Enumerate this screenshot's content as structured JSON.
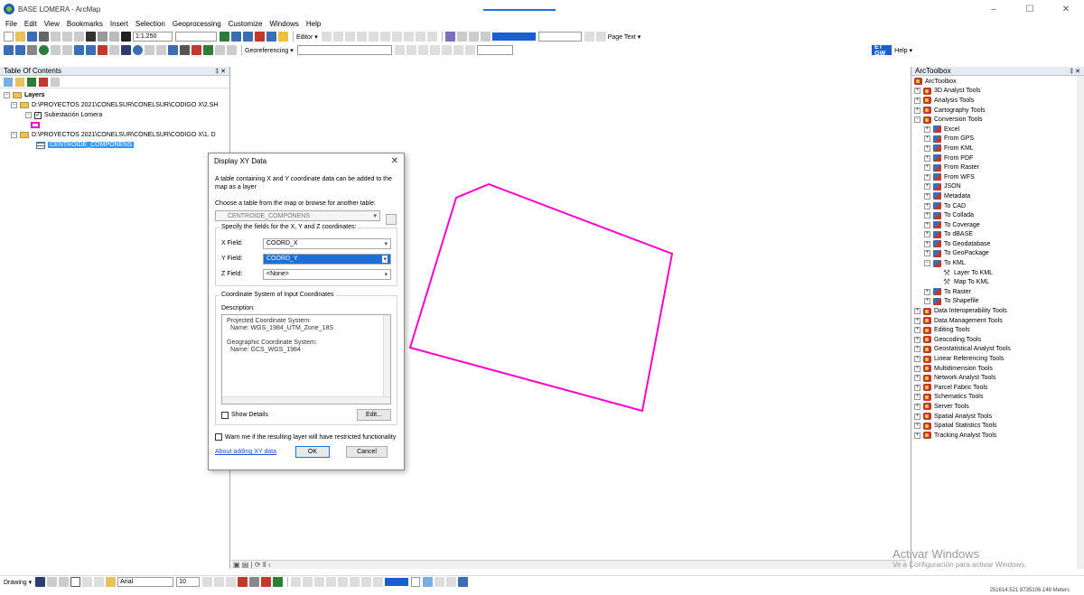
{
  "window": {
    "title": "BASE LOMERA - ArcMap",
    "controls": [
      "–",
      "☐",
      "✕"
    ]
  },
  "menu": [
    "File",
    "Edit",
    "View",
    "Bookmarks",
    "Insert",
    "Selection",
    "Geoprocessing",
    "Customize",
    "Windows",
    "Help"
  ],
  "toolbar": {
    "scale": "1:1.250",
    "editor_label": "Editor ▾",
    "page_text_label": "Page Text ▾",
    "georeferencing_label": "Georeferencing ▾",
    "help_label": "Help ▾",
    "etgw_label": "ET GW"
  },
  "toc": {
    "title": "Table Of Contents",
    "pins": "‡ ✕",
    "layers_label": "Layers",
    "folder1": "D:\\PROYECTOS 2021\\CONELSUR\\CONELSUR\\CODIGO X\\2.SH",
    "layer1": "Subestación Lomera",
    "folder2": "D:\\PROYECTOS 2021\\CONELSUR\\CONELSUR\\CODIGO X\\1. D",
    "table1": "CENTROIDE_COMPONENS"
  },
  "arctoolbox": {
    "title": "ArcToolbox",
    "pins": "‡ ✕",
    "root": "ArcToolbox",
    "items": [
      {
        "level": 1,
        "kind": "box",
        "exp": "+",
        "label": "3D Analyst Tools"
      },
      {
        "level": 1,
        "kind": "box",
        "exp": "+",
        "label": "Analysis Tools"
      },
      {
        "level": 1,
        "kind": "box",
        "exp": "+",
        "label": "Cartography Tools"
      },
      {
        "level": 1,
        "kind": "box",
        "exp": "-",
        "label": "Conversion Tools"
      },
      {
        "level": 2,
        "kind": "set",
        "exp": "+",
        "label": "Excel"
      },
      {
        "level": 2,
        "kind": "set",
        "exp": "+",
        "label": "From GPS"
      },
      {
        "level": 2,
        "kind": "set",
        "exp": "+",
        "label": "From KML"
      },
      {
        "level": 2,
        "kind": "set",
        "exp": "+",
        "label": "From PDF"
      },
      {
        "level": 2,
        "kind": "set",
        "exp": "+",
        "label": "From Raster"
      },
      {
        "level": 2,
        "kind": "set",
        "exp": "+",
        "label": "From WFS"
      },
      {
        "level": 2,
        "kind": "set",
        "exp": "+",
        "label": "JSON"
      },
      {
        "level": 2,
        "kind": "set",
        "exp": "+",
        "label": "Metadata"
      },
      {
        "level": 2,
        "kind": "set",
        "exp": "+",
        "label": "To CAD"
      },
      {
        "level": 2,
        "kind": "set",
        "exp": "+",
        "label": "To Collada"
      },
      {
        "level": 2,
        "kind": "set",
        "exp": "+",
        "label": "To Coverage"
      },
      {
        "level": 2,
        "kind": "set",
        "exp": "+",
        "label": "To dBASE"
      },
      {
        "level": 2,
        "kind": "set",
        "exp": "+",
        "label": "To Geodatabase"
      },
      {
        "level": 2,
        "kind": "set",
        "exp": "+",
        "label": "To GeoPackage"
      },
      {
        "level": 2,
        "kind": "set",
        "exp": "-",
        "label": "To KML"
      },
      {
        "level": 3,
        "kind": "tool",
        "exp": "",
        "label": "Layer To KML"
      },
      {
        "level": 3,
        "kind": "tool",
        "exp": "",
        "label": "Map To KML"
      },
      {
        "level": 2,
        "kind": "set",
        "exp": "+",
        "label": "To Raster"
      },
      {
        "level": 2,
        "kind": "set",
        "exp": "+",
        "label": "To Shapefile"
      },
      {
        "level": 1,
        "kind": "box",
        "exp": "+",
        "label": "Data Interoperability Tools"
      },
      {
        "level": 1,
        "kind": "box",
        "exp": "+",
        "label": "Data Management Tools"
      },
      {
        "level": 1,
        "kind": "box",
        "exp": "+",
        "label": "Editing Tools"
      },
      {
        "level": 1,
        "kind": "box",
        "exp": "+",
        "label": "Geocoding Tools"
      },
      {
        "level": 1,
        "kind": "box",
        "exp": "+",
        "label": "Geostatistical Analyst Tools"
      },
      {
        "level": 1,
        "kind": "box",
        "exp": "+",
        "label": "Linear Referencing Tools"
      },
      {
        "level": 1,
        "kind": "box",
        "exp": "+",
        "label": "Multidimension Tools"
      },
      {
        "level": 1,
        "kind": "box",
        "exp": "+",
        "label": "Network Analyst Tools"
      },
      {
        "level": 1,
        "kind": "box",
        "exp": "+",
        "label": "Parcel Fabric Tools"
      },
      {
        "level": 1,
        "kind": "box",
        "exp": "+",
        "label": "Schematics Tools"
      },
      {
        "level": 1,
        "kind": "box",
        "exp": "+",
        "label": "Server Tools"
      },
      {
        "level": 1,
        "kind": "box",
        "exp": "+",
        "label": "Spatial Analyst Tools"
      },
      {
        "level": 1,
        "kind": "box",
        "exp": "+",
        "label": "Spatial Statistics Tools"
      },
      {
        "level": 1,
        "kind": "box",
        "exp": "+",
        "label": "Tracking Analyst Tools"
      }
    ]
  },
  "dialog": {
    "title": "Display XY Data",
    "close": "✕",
    "description": "A table containing X and Y coordinate data can be added to the map as a layer",
    "choose_label": "Choose a table from the map or browse for another table:",
    "table_value": "CENTROIDE_COMPONENS",
    "fields_legend": "Specify the fields for the X, Y and Z coordinates:",
    "x_label": "X Field:",
    "x_value": "COORD_X",
    "y_label": "Y Field:",
    "y_value": "COORD_Y",
    "z_label": "Z Field:",
    "z_value": "<None>",
    "coord_legend": "Coordinate System of Input Coordinates",
    "desc_label": "Description:",
    "desc_projected": "Projected Coordinate System:",
    "desc_projected_name": "Name: WGS_1984_UTM_Zone_18S",
    "desc_geographic": "Geographic Coordinate System:",
    "desc_geographic_name": "Name: GCS_WGS_1984",
    "show_details": "Show Details",
    "edit": "Edit...",
    "warn": "Warn me if the resulting layer will have restricted functionality",
    "about_link": "About adding XY data",
    "ok": "OK",
    "cancel": "Cancel"
  },
  "map": {
    "polygon_color": "#ff00cc"
  },
  "drawing": {
    "label": "Drawing ▾",
    "font": "Arial",
    "size": "10"
  },
  "watermark": {
    "title": "Activar Windows",
    "subtitle": "Ve a Configuración para activar Windows."
  },
  "status": {
    "coords": "251614.521  8735106.148 Meters"
  }
}
